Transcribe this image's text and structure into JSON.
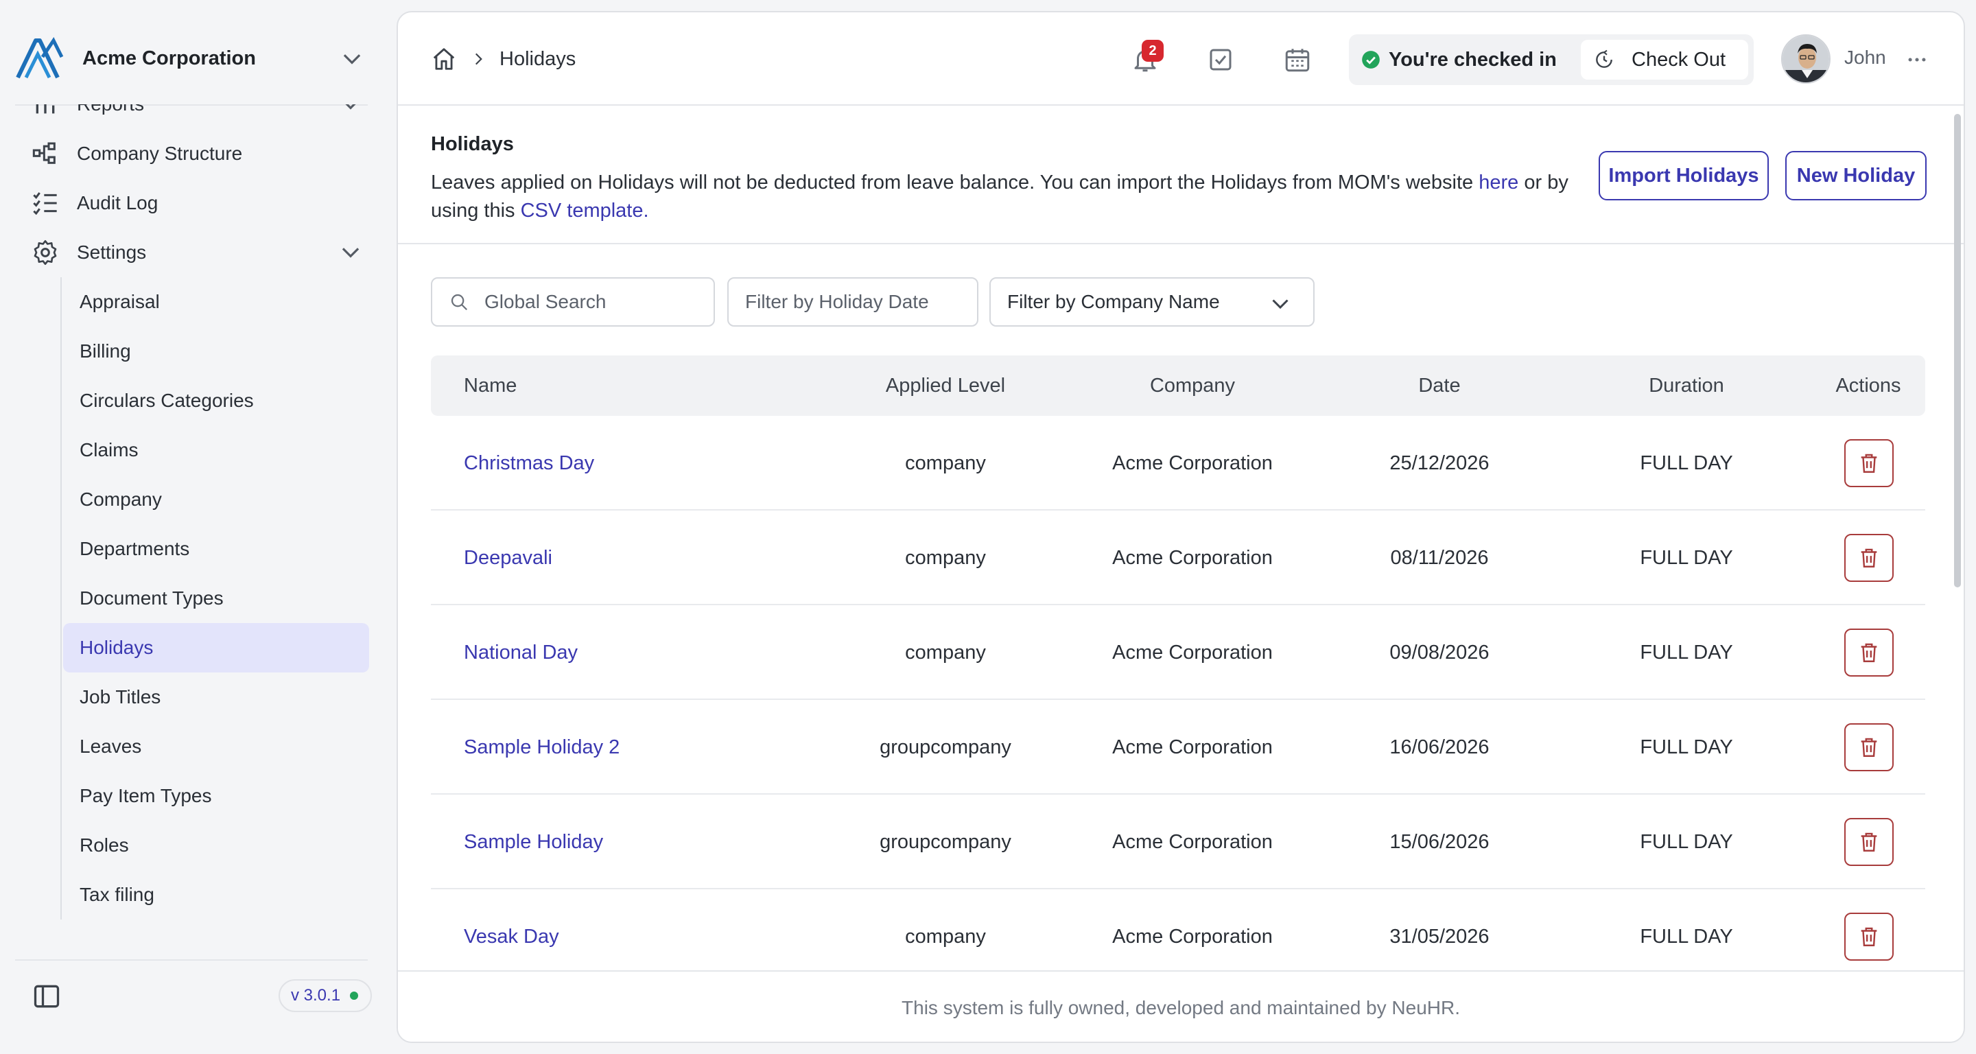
{
  "brand": {
    "name": "Acme Corporation"
  },
  "nav": {
    "items": [
      {
        "label": "Reports",
        "icon": "reports-icon"
      },
      {
        "label": "Company Structure",
        "icon": "hierarchy-icon"
      },
      {
        "label": "Audit Log",
        "icon": "checklist-icon"
      },
      {
        "label": "Settings",
        "icon": "gear-icon"
      }
    ],
    "settings_sub": [
      "Appraisal",
      "Billing",
      "Circulars Categories",
      "Claims",
      "Company",
      "Departments",
      "Document Types",
      "Holidays",
      "Job Titles",
      "Leaves",
      "Pay Item Types",
      "Roles",
      "Tax filing"
    ],
    "active_sub": "Holidays"
  },
  "version": "v 3.0.1",
  "topbar": {
    "breadcrumb": "Holidays",
    "notification_count": "2",
    "checkin_status": "You're checked in",
    "checkout_label": "Check Out",
    "user_name": "John"
  },
  "intro": {
    "title": "Holidays",
    "desc_part1": "Leaves applied on Holidays will not be deducted from leave balance. You can import the Holidays from MOM's website ",
    "link_here": "here",
    "desc_part2": " or by using this ",
    "link_csv": "CSV template.",
    "import_label": "Import Holidays",
    "new_label": "New Holiday"
  },
  "filters": {
    "search_placeholder": "Global Search",
    "date_placeholder": "Filter by Holiday Date",
    "company_placeholder": "Filter by Company Name"
  },
  "table": {
    "headers": [
      "Name",
      "Applied Level",
      "Company",
      "Date",
      "Duration",
      "Actions"
    ],
    "rows": [
      [
        "Christmas Day",
        "company",
        "Acme Corporation",
        "25/12/2026",
        "FULL DAY"
      ],
      [
        "Deepavali",
        "company",
        "Acme Corporation",
        "08/11/2026",
        "FULL DAY"
      ],
      [
        "National Day",
        "company",
        "Acme Corporation",
        "09/08/2026",
        "FULL DAY"
      ],
      [
        "Sample Holiday 2",
        "groupcompany",
        "Acme Corporation",
        "16/06/2026",
        "FULL DAY"
      ],
      [
        "Sample Holiday",
        "groupcompany",
        "Acme Corporation",
        "15/06/2026",
        "FULL DAY"
      ],
      [
        "Vesak Day",
        "company",
        "Acme Corporation",
        "31/05/2026",
        "FULL DAY"
      ]
    ]
  },
  "footer": "This system is fully owned, developed and maintained by NeuHR.",
  "colors": {
    "accent": "#3a38b0",
    "danger": "#a83c3c",
    "success": "#22a45a"
  }
}
